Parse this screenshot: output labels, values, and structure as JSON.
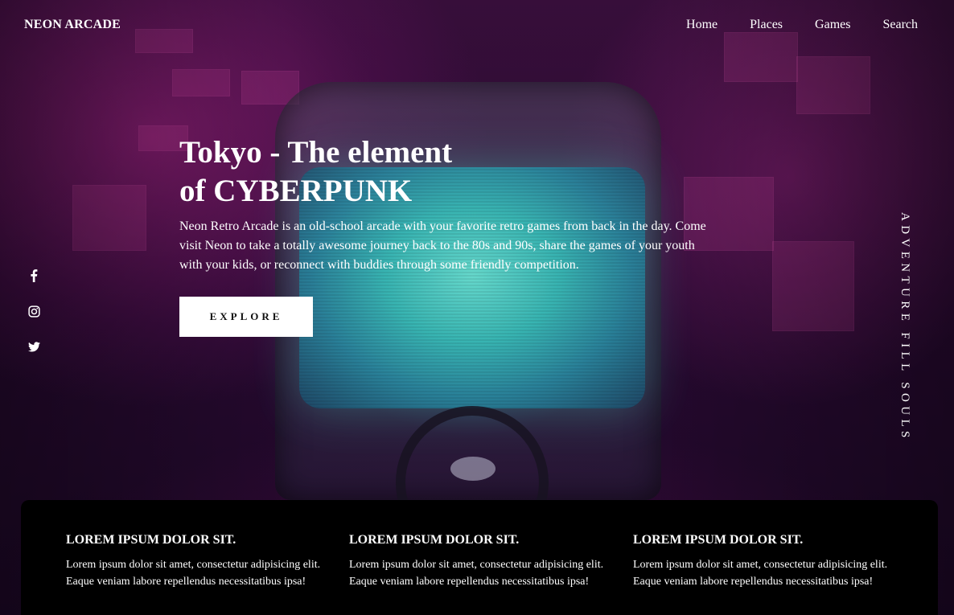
{
  "brand": {
    "name": "NEON ARCADE"
  },
  "nav": {
    "items": [
      {
        "label": "Home"
      },
      {
        "label": "Places"
      },
      {
        "label": "Games"
      },
      {
        "label": "Search"
      }
    ]
  },
  "hero": {
    "title_line1": "Tokyo - The element",
    "title_line2": "of CYBERPUNK",
    "description": "Neon Retro Arcade is an old-school arcade with your favorite retro games from back in the day. Come visit Neon to take a totally awesome journey back to the 80s and 90s, share the games of your youth with your kids, or reconnect with buddies through some friendly competition.",
    "cta_label": "EXPLORE"
  },
  "social": {
    "icons": [
      "facebook-icon",
      "instagram-icon",
      "twitter-icon"
    ]
  },
  "tagline": "ADVENTURE FILL SOULS",
  "features": [
    {
      "title": "LOREM IPSUM DOLOR SIT.",
      "text": "Lorem ipsum dolor sit amet, consectetur adipisicing elit. Eaque veniam labore repellendus necessitatibus ipsa!"
    },
    {
      "title": "LOREM IPSUM DOLOR SIT.",
      "text": "Lorem ipsum dolor sit amet, consectetur adipisicing elit. Eaque veniam labore repellendus necessitatibus ipsa!"
    },
    {
      "title": "LOREM IPSUM DOLOR SIT.",
      "text": "Lorem ipsum dolor sit amet, consectetur adipisicing elit. Eaque veniam labore repellendus necessitatibus ipsa!"
    }
  ],
  "colors": {
    "panel_bg": "#000000",
    "button_bg": "#ffffff",
    "text": "#ffffff",
    "neon_magenta": "#b8288f",
    "screen_teal": "#3cc9c4"
  }
}
